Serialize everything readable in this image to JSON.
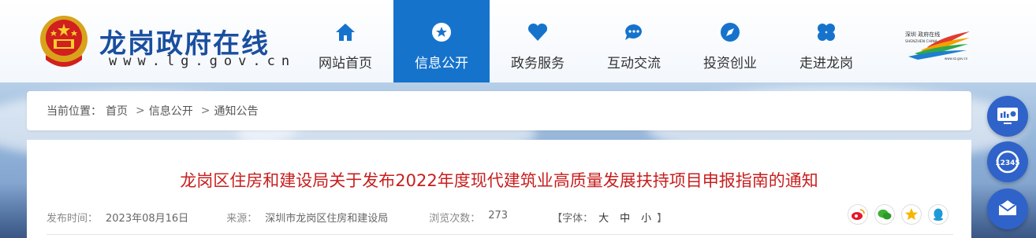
{
  "header": {
    "site_title": "龙岗政府在线",
    "site_url": "www.lg.gov.cn",
    "brand_color": "#1673cc",
    "sz_logo_text_top": "深圳 政府在线",
    "sz_logo_text_bottom": "SHENZHEN CHINA",
    "sz_logo_url": "www.sz.gov.cn"
  },
  "nav": {
    "items": [
      {
        "label": "网站首页",
        "icon": "home-icon"
      },
      {
        "label": "信息公开",
        "icon": "star-icon"
      },
      {
        "label": "政务服务",
        "icon": "heart-icon"
      },
      {
        "label": "互动交流",
        "icon": "chat-icon"
      },
      {
        "label": "投资创业",
        "icon": "compass-icon"
      },
      {
        "label": "走进龙岗",
        "icon": "clover-icon"
      }
    ],
    "active_index": 1
  },
  "breadcrumb": {
    "prefix": "当前位置：",
    "items": [
      "首页",
      "信息公开",
      "通知公告"
    ],
    "separator": ">"
  },
  "article": {
    "title": "龙岗区住房和建设局关于发布2022年度现代建筑业高质量发展扶持项目申报指南的通知",
    "title_color": "#c81e1e",
    "publish_label": "发布时间：",
    "publish_date": "2023年08月16日",
    "source_label": "来源：",
    "source": "深圳市龙岗区住房和建设局",
    "views_label": "浏览次数：",
    "views": "273",
    "font_label": "【字体：",
    "font_large": "大",
    "font_medium": "中",
    "font_small": "小",
    "font_close": "】"
  },
  "share_icons": [
    "weibo-icon",
    "wechat-icon",
    "qzone-icon",
    "qq-icon"
  ],
  "float_buttons": [
    "monitor-chart-icon",
    "hotline-12345-icon",
    "mail-icon"
  ],
  "float_hotline": "12345"
}
